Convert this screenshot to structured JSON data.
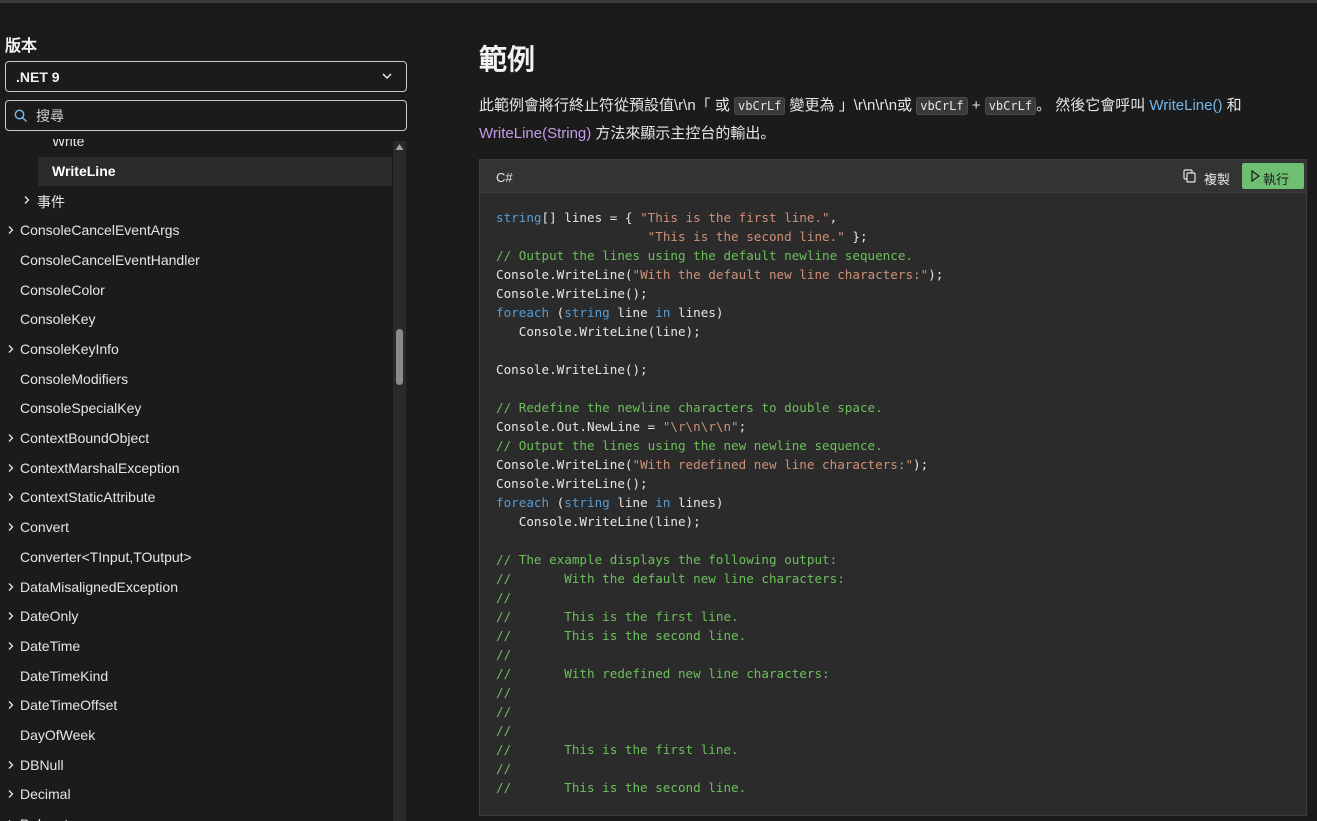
{
  "sidebar": {
    "version_label": "版本",
    "version_value": ".NET 9",
    "search_placeholder": "搜尋",
    "toc_items": [
      {
        "label": "Write",
        "indent": 2,
        "arrow": false,
        "active": false
      },
      {
        "label": "WriteLine",
        "indent": 2,
        "arrow": false,
        "active": true
      },
      {
        "label": "事件",
        "indent": 1,
        "arrow": true,
        "active": false
      },
      {
        "label": "ConsoleCancelEventArgs",
        "indent": 0,
        "arrow": true,
        "active": false
      },
      {
        "label": "ConsoleCancelEventHandler",
        "indent": 0,
        "arrow": false,
        "active": false
      },
      {
        "label": "ConsoleColor",
        "indent": 0,
        "arrow": false,
        "active": false
      },
      {
        "label": "ConsoleKey",
        "indent": 0,
        "arrow": false,
        "active": false
      },
      {
        "label": "ConsoleKeyInfo",
        "indent": 0,
        "arrow": true,
        "active": false
      },
      {
        "label": "ConsoleModifiers",
        "indent": 0,
        "arrow": false,
        "active": false
      },
      {
        "label": "ConsoleSpecialKey",
        "indent": 0,
        "arrow": false,
        "active": false
      },
      {
        "label": "ContextBoundObject",
        "indent": 0,
        "arrow": true,
        "active": false
      },
      {
        "label": "ContextMarshalException",
        "indent": 0,
        "arrow": true,
        "active": false
      },
      {
        "label": "ContextStaticAttribute",
        "indent": 0,
        "arrow": true,
        "active": false
      },
      {
        "label": "Convert",
        "indent": 0,
        "arrow": true,
        "active": false
      },
      {
        "label": "Converter<TInput,TOutput>",
        "indent": 0,
        "arrow": false,
        "active": false
      },
      {
        "label": "DataMisalignedException",
        "indent": 0,
        "arrow": true,
        "active": false
      },
      {
        "label": "DateOnly",
        "indent": 0,
        "arrow": true,
        "active": false
      },
      {
        "label": "DateTime",
        "indent": 0,
        "arrow": true,
        "active": false
      },
      {
        "label": "DateTimeKind",
        "indent": 0,
        "arrow": false,
        "active": false
      },
      {
        "label": "DateTimeOffset",
        "indent": 0,
        "arrow": true,
        "active": false
      },
      {
        "label": "DayOfWeek",
        "indent": 0,
        "arrow": false,
        "active": false
      },
      {
        "label": "DBNull",
        "indent": 0,
        "arrow": true,
        "active": false
      },
      {
        "label": "Decimal",
        "indent": 0,
        "arrow": true,
        "active": false
      },
      {
        "label": "Delegate",
        "indent": 0,
        "arrow": true,
        "active": false
      }
    ]
  },
  "main": {
    "heading": "範例",
    "para": {
      "t1": "此範例會將行終止符從預設值\\r\\n「 或 ",
      "code1": "vbCrLf",
      "t2": " 變更為 」\\r\\n\\r\\n或 ",
      "code2": "vbCrLf",
      "t3": " + ",
      "code3": "vbCrLf",
      "t4": "。 然後它會呼叫 ",
      "link1": "WriteLine()",
      "t5": " 和 ",
      "link2": "WriteLine(String)",
      "t6": " 方法來顯示主控台的輸出。"
    },
    "code_block": {
      "language": "C#",
      "copy_label": "複製",
      "run_label": "執行",
      "lines": [
        [
          [
            "kw",
            "string"
          ],
          [
            "",
            "[] lines = { "
          ],
          [
            "str",
            "\"This is the first line.\""
          ],
          [
            "",
            ","
          ]
        ],
        [
          [
            "",
            "                    "
          ],
          [
            "str",
            "\"This is the second line.\""
          ],
          [
            "",
            " };"
          ]
        ],
        [
          [
            "cm",
            "// Output the lines using the default newline sequence."
          ]
        ],
        [
          [
            "",
            "Console.WriteLine("
          ],
          [
            "str",
            "\"With the default new line characters:\""
          ],
          [
            "",
            ");"
          ]
        ],
        [
          [
            "",
            "Console.WriteLine();"
          ]
        ],
        [
          [
            "kw",
            "foreach"
          ],
          [
            "",
            " ("
          ],
          [
            "kw",
            "string"
          ],
          [
            "",
            " line "
          ],
          [
            "kw",
            "in"
          ],
          [
            "",
            " lines)"
          ]
        ],
        [
          [
            "",
            "   Console.WriteLine(line);"
          ]
        ],
        [
          [
            "",
            ""
          ]
        ],
        [
          [
            "",
            "Console.WriteLine();"
          ]
        ],
        [
          [
            "",
            ""
          ]
        ],
        [
          [
            "cm",
            "// Redefine the newline characters to double space."
          ]
        ],
        [
          [
            "",
            "Console.Out.NewLine = "
          ],
          [
            "str",
            "\"\\r\\n\\r\\n\""
          ],
          [
            "",
            ";"
          ]
        ],
        [
          [
            "cm",
            "// Output the lines using the new newline sequence."
          ]
        ],
        [
          [
            "",
            "Console.WriteLine("
          ],
          [
            "str",
            "\"With redefined new line characters:\""
          ],
          [
            "",
            ");"
          ]
        ],
        [
          [
            "",
            "Console.WriteLine();"
          ]
        ],
        [
          [
            "kw",
            "foreach"
          ],
          [
            "",
            " ("
          ],
          [
            "kw",
            "string"
          ],
          [
            "",
            " line "
          ],
          [
            "kw",
            "in"
          ],
          [
            "",
            " lines)"
          ]
        ],
        [
          [
            "",
            "   Console.WriteLine(line);"
          ]
        ],
        [
          [
            "",
            ""
          ]
        ],
        [
          [
            "cm",
            "// The example displays the following output:"
          ]
        ],
        [
          [
            "cm",
            "//       With the default new line characters:"
          ]
        ],
        [
          [
            "cm",
            "//"
          ]
        ],
        [
          [
            "cm",
            "//       This is the first line."
          ]
        ],
        [
          [
            "cm",
            "//       This is the second line."
          ]
        ],
        [
          [
            "cm",
            "//"
          ]
        ],
        [
          [
            "cm",
            "//       With redefined new line characters:"
          ]
        ],
        [
          [
            "cm",
            "//"
          ]
        ],
        [
          [
            "cm",
            "//"
          ]
        ],
        [
          [
            "cm",
            "//"
          ]
        ],
        [
          [
            "cm",
            "//       This is the first line."
          ]
        ],
        [
          [
            "cm",
            "//"
          ]
        ],
        [
          [
            "cm",
            "//       This is the second line."
          ]
        ]
      ]
    }
  },
  "colors": {
    "background": "#1b1b1b",
    "link": "#75b6e7",
    "visited_link": "#c49ce8",
    "run_button": "#6fbf73",
    "keyword": "#569cd6",
    "string": "#ce9178",
    "comment": "#6cbf5c"
  },
  "icons": {
    "version_chevron": "chevron-down-icon",
    "search": "search-icon",
    "copy": "copy-icon",
    "run": "play-icon",
    "toc_expand": "chevron-right-icon"
  }
}
